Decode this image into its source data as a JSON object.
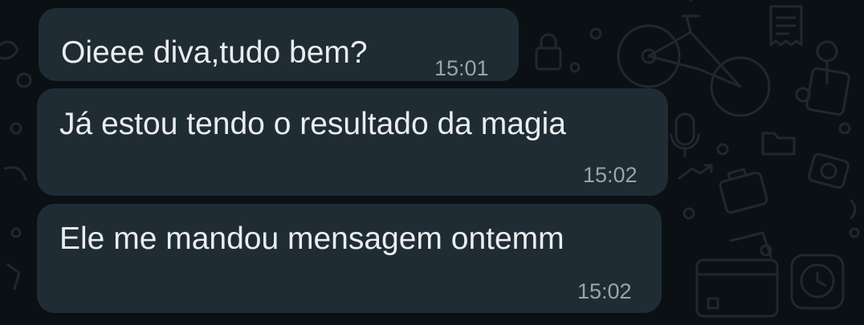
{
  "chat": {
    "messages": [
      {
        "text": "Oieee diva,tudo bem?",
        "time": "15:01"
      },
      {
        "text": "Já estou tendo o resultado da magia",
        "time": "15:02"
      },
      {
        "text": "Ele me mandou mensagem ontemm",
        "time": "15:02"
      }
    ]
  },
  "theme": {
    "background": "#0b1014",
    "bubble": "#202c33",
    "text": "#e9edef",
    "timestamp": "#9aa4aa",
    "doodle": "#1f282e"
  },
  "wallpaper": {
    "icons": [
      "bicycle-icon",
      "receipt-icon",
      "pin-icon",
      "lock-icon",
      "microphone-icon",
      "suitcase-icon",
      "credit-card-icon",
      "clock-icon",
      "chart-icon",
      "folder-icon",
      "camera-icon"
    ]
  }
}
